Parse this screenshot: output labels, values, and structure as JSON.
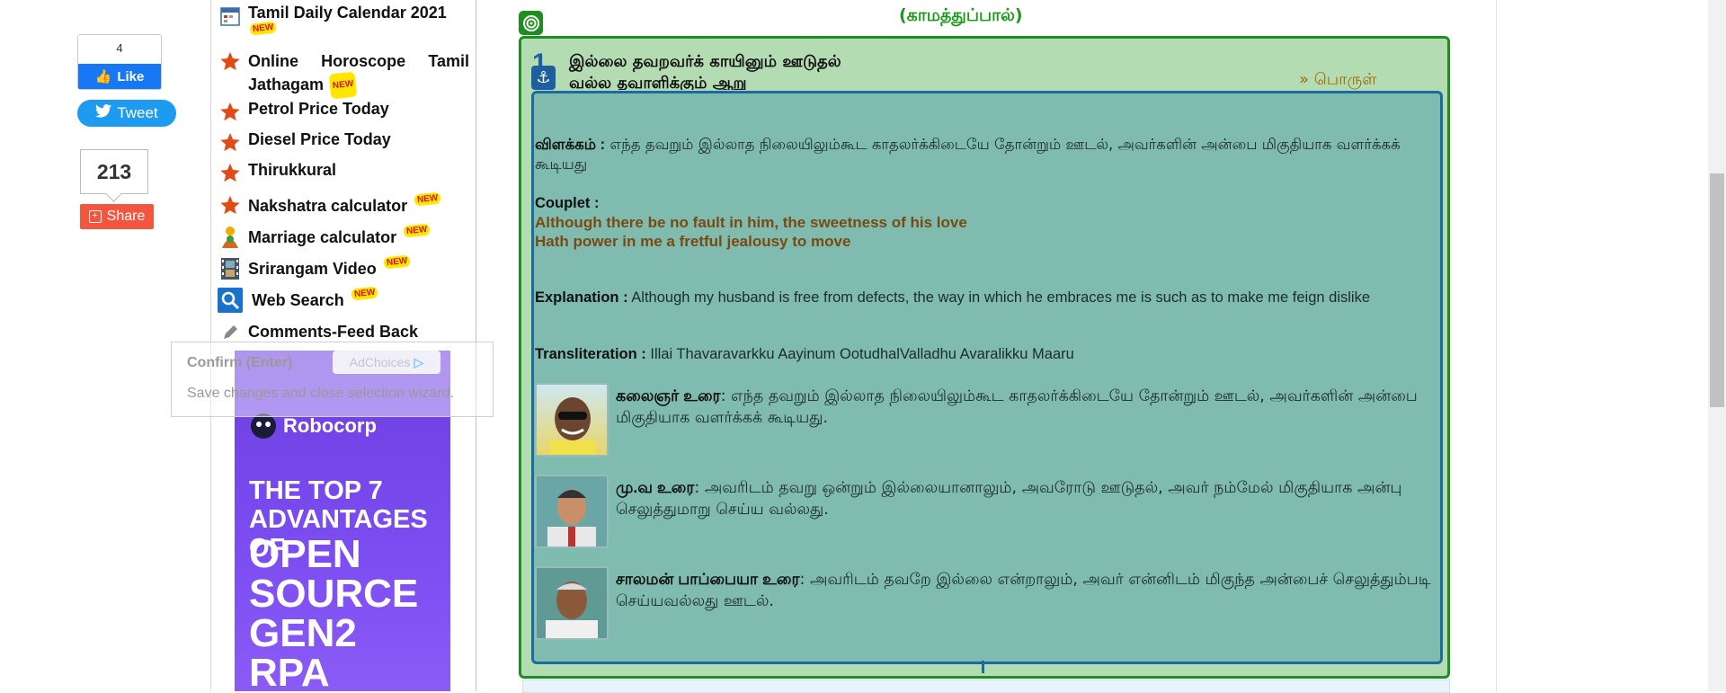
{
  "social": {
    "fb_count": "4",
    "fb_like_label": "Like",
    "tweet_label": "Tweet",
    "share_count": "213",
    "share_label": "Share"
  },
  "sidebar": {
    "items": [
      {
        "label": "Tamil Daily Calendar 2021",
        "badge": "NEW",
        "icon": "calendar-icon"
      },
      {
        "label": "Online Horoscope Tamil Jathagam",
        "badge": "NEW",
        "icon": "star-icon"
      },
      {
        "label": "Petrol Price Today",
        "icon": "star-icon"
      },
      {
        "label": "Diesel Price Today",
        "icon": "star-icon"
      },
      {
        "label": "Thirukkural",
        "icon": "star-icon"
      },
      {
        "label": "Nakshatra calculator",
        "badge": "NEW",
        "icon": "star-icon"
      },
      {
        "label": "Marriage calculator",
        "badge": "NEW",
        "icon": "wedding-icon"
      },
      {
        "label": "Srirangam Video",
        "badge": "NEW",
        "icon": "film-icon"
      },
      {
        "label": "Web Search",
        "badge": "NEW",
        "icon": "search-icon"
      },
      {
        "label": "Comments-Feed Back",
        "icon": "pencil-icon"
      }
    ]
  },
  "ad": {
    "choices_label": "AdChoices",
    "brand": "Robocorp",
    "headline_small": "THE TOP 7 ADVANTAGES OF",
    "headline_big": "OPEN SOURCE GEN2 RPA"
  },
  "tooltip": {
    "title": "Confirm (Enter)",
    "text": "Save changes and close selection wizard."
  },
  "main": {
    "section_title": "(காமத்துப்பால்)",
    "kural_number": "1",
    "kural_line1": "இல்லை தவறவர்க் காயினும் ஊடுதல்",
    "kural_line2": "வல்ல தவாளிக்கும் ஆறு",
    "porul_link": "» பொருள்",
    "vilakkam_label": "விளக்கம் :",
    "vilakkam_text": "எந்த தவறும் இல்லாத நிலையிலும்கூட காதலர்க்கிடையே தோன்றும் ஊடல், அவர்களின் அன்பை மிகுதியாக வளர்க்கக் கூடியது",
    "couplet_label": "Couplet :",
    "couplet_line1": "Although there be no fault in him, the sweetness of his love",
    "couplet_line2": "Hath power in me a fretful jealousy to move",
    "explanation_label": "Explanation :",
    "explanation_text": "Although my husband is free from defects, the way in which he embraces me is such as to make me feign dislike",
    "transliteration_label": "Transliteration :",
    "transliteration_text": "Illai Thavaravarkku Aayinum OotudhalValladhu Avaralikku Maaru",
    "commentaries": [
      {
        "author": "கலைஞர் உரை",
        "text": ": எந்த தவறும் இல்லாத நிலையிலும்கூட காதலர்க்கிடையே தோன்றும் ஊடல், அவர்களின் அன்பை மிகுதியாக வளர்க்கக் கூடியது."
      },
      {
        "author": "மு.வ உரை",
        "text": ": அவரிடம் தவறு ஒன்றும் இல்லையானாலும், அவரோடு ஊடுதல், அவர் நம்மேல் மிகுதியாக அன்பு செலுத்துமாறு செய்ய வல்லது."
      },
      {
        "author": "சாலமன் பாப்பையா உரை",
        "text": ": அவரிடம் தவறே இல்லை என்றாலும், அவர் என்னிடம் மிகுந்த அன்பைச் செலுத்தும்படி செய்யவல்லது ஊடல்."
      }
    ]
  },
  "colors": {
    "green_border": "#1e8f1e",
    "teal_bg": "#7fbbae",
    "blue_border": "#1c6ba0",
    "couplet_brown": "#7a4a12"
  }
}
